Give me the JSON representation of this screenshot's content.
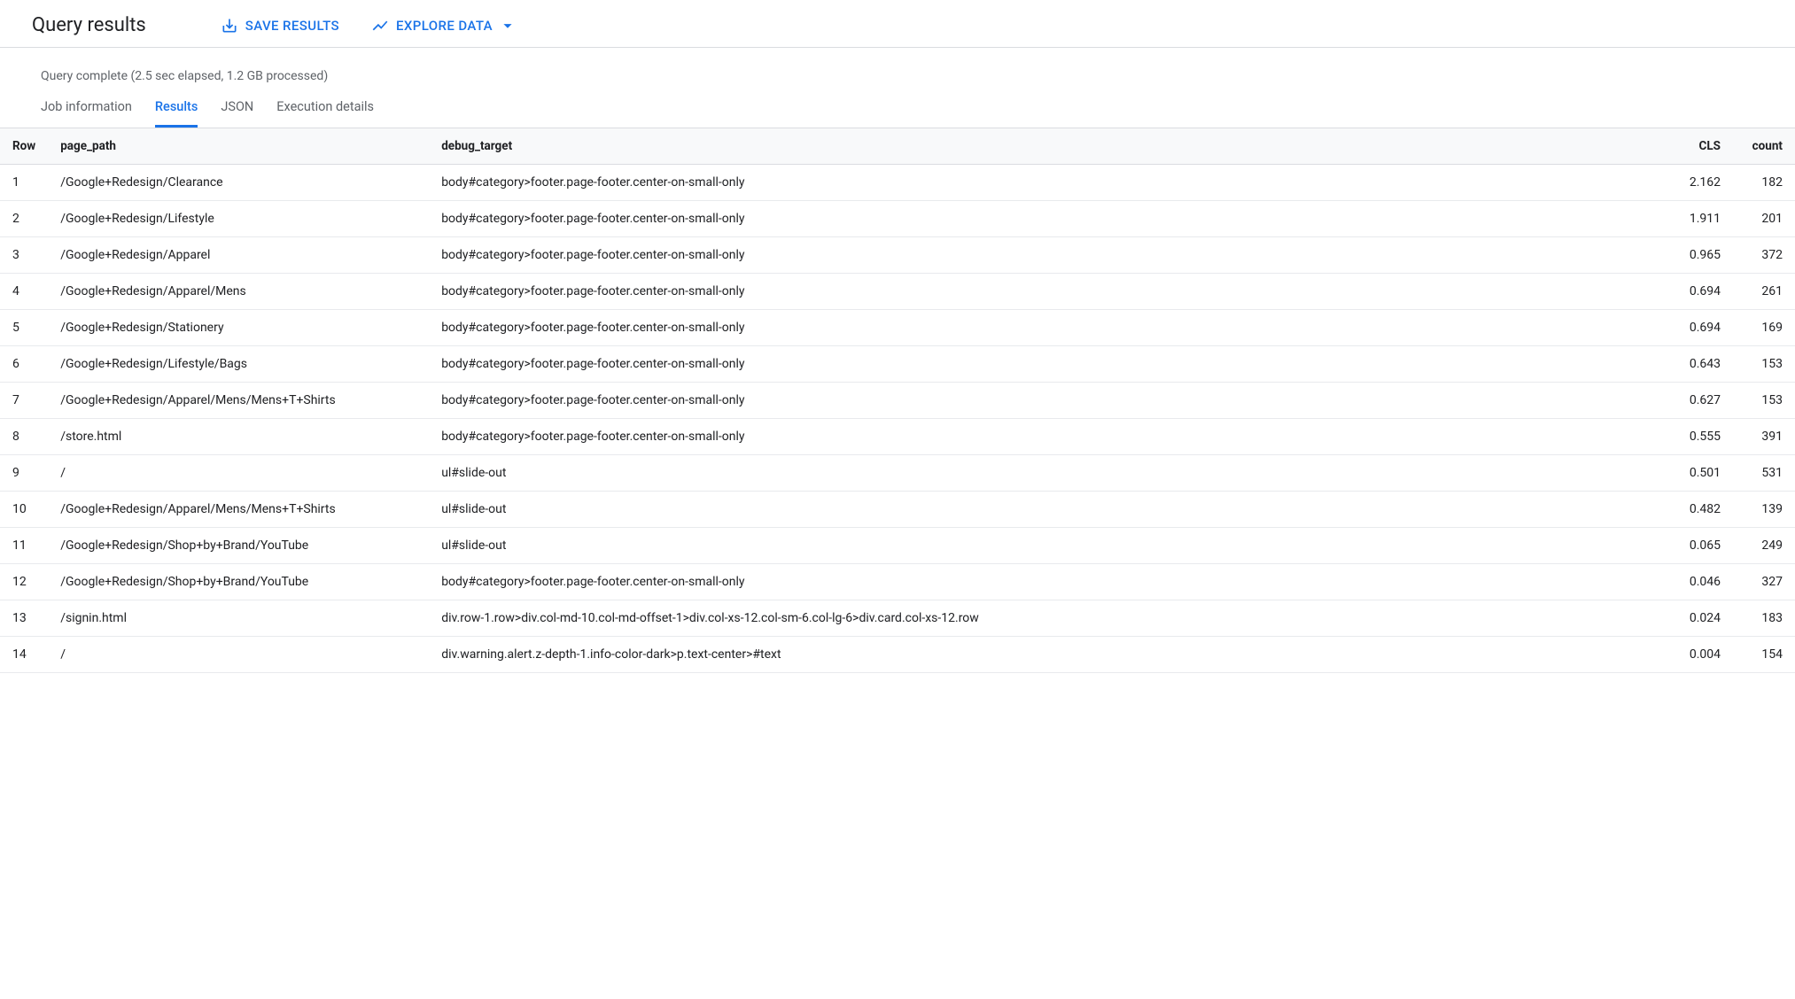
{
  "header": {
    "title": "Query results",
    "save_button": "SAVE RESULTS",
    "explore_button": "EXPLORE DATA"
  },
  "status": {
    "text": "Query complete (2.5 sec elapsed, 1.2 GB processed)"
  },
  "tabs": {
    "job_info": "Job information",
    "results": "Results",
    "json": "JSON",
    "execution": "Execution details"
  },
  "columns": {
    "row": "Row",
    "page_path": "page_path",
    "debug_target": "debug_target",
    "cls": "CLS",
    "count": "count"
  },
  "rows": [
    {
      "row": "1",
      "page_path": "/Google+Redesign/Clearance",
      "debug_target": "body#category>footer.page-footer.center-on-small-only",
      "cls": "2.162",
      "count": "182"
    },
    {
      "row": "2",
      "page_path": "/Google+Redesign/Lifestyle",
      "debug_target": "body#category>footer.page-footer.center-on-small-only",
      "cls": "1.911",
      "count": "201"
    },
    {
      "row": "3",
      "page_path": "/Google+Redesign/Apparel",
      "debug_target": "body#category>footer.page-footer.center-on-small-only",
      "cls": "0.965",
      "count": "372"
    },
    {
      "row": "4",
      "page_path": "/Google+Redesign/Apparel/Mens",
      "debug_target": "body#category>footer.page-footer.center-on-small-only",
      "cls": "0.694",
      "count": "261"
    },
    {
      "row": "5",
      "page_path": "/Google+Redesign/Stationery",
      "debug_target": "body#category>footer.page-footer.center-on-small-only",
      "cls": "0.694",
      "count": "169"
    },
    {
      "row": "6",
      "page_path": "/Google+Redesign/Lifestyle/Bags",
      "debug_target": "body#category>footer.page-footer.center-on-small-only",
      "cls": "0.643",
      "count": "153"
    },
    {
      "row": "7",
      "page_path": "/Google+Redesign/Apparel/Mens/Mens+T+Shirts",
      "debug_target": "body#category>footer.page-footer.center-on-small-only",
      "cls": "0.627",
      "count": "153"
    },
    {
      "row": "8",
      "page_path": "/store.html",
      "debug_target": "body#category>footer.page-footer.center-on-small-only",
      "cls": "0.555",
      "count": "391"
    },
    {
      "row": "9",
      "page_path": "/",
      "debug_target": "ul#slide-out",
      "cls": "0.501",
      "count": "531"
    },
    {
      "row": "10",
      "page_path": "/Google+Redesign/Apparel/Mens/Mens+T+Shirts",
      "debug_target": "ul#slide-out",
      "cls": "0.482",
      "count": "139"
    },
    {
      "row": "11",
      "page_path": "/Google+Redesign/Shop+by+Brand/YouTube",
      "debug_target": "ul#slide-out",
      "cls": "0.065",
      "count": "249"
    },
    {
      "row": "12",
      "page_path": "/Google+Redesign/Shop+by+Brand/YouTube",
      "debug_target": "body#category>footer.page-footer.center-on-small-only",
      "cls": "0.046",
      "count": "327"
    },
    {
      "row": "13",
      "page_path": "/signin.html",
      "debug_target": "div.row-1.row>div.col-md-10.col-md-offset-1>div.col-xs-12.col-sm-6.col-lg-6>div.card.col-xs-12.row",
      "cls": "0.024",
      "count": "183"
    },
    {
      "row": "14",
      "page_path": "/",
      "debug_target": "div.warning.alert.z-depth-1.info-color-dark>p.text-center>#text",
      "cls": "0.004",
      "count": "154"
    }
  ]
}
